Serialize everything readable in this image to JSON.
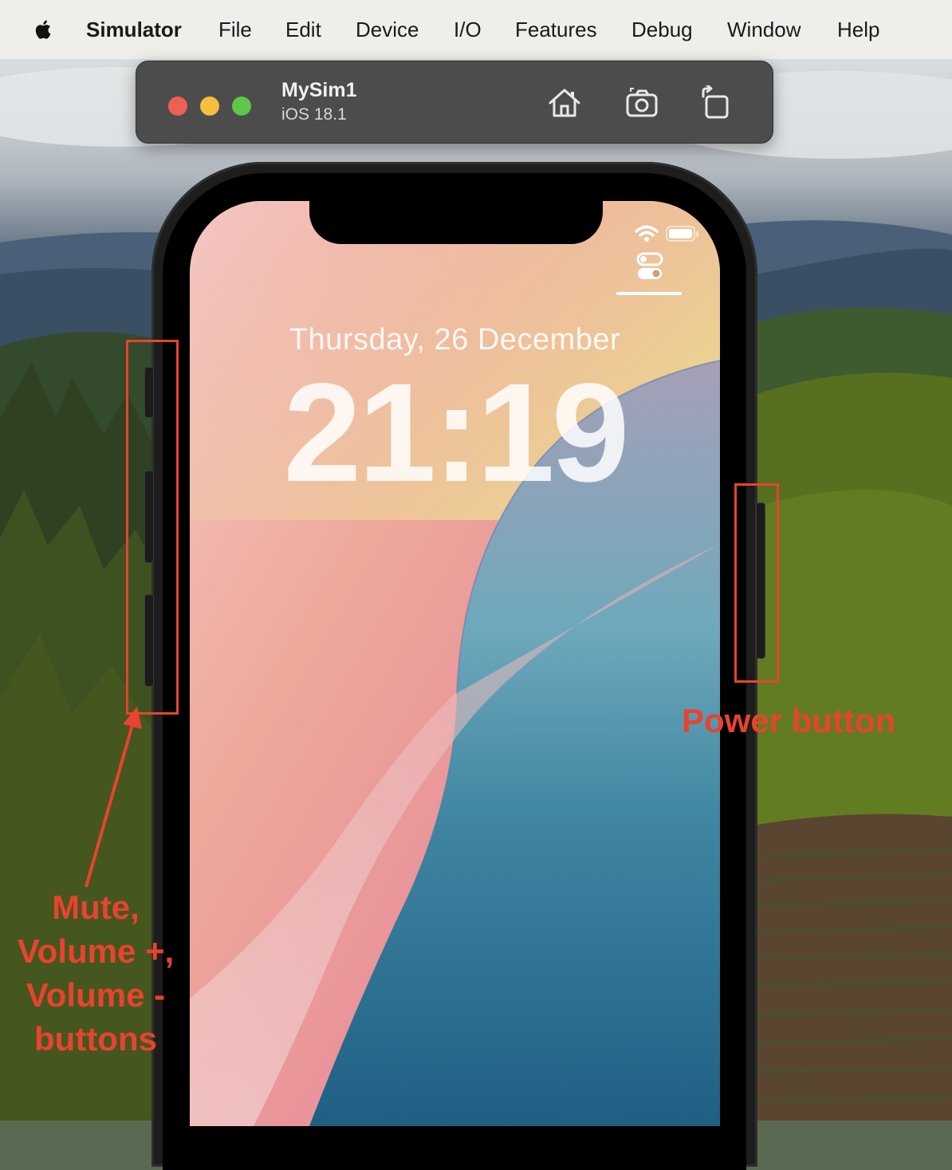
{
  "menubar": {
    "apple_icon": "apple-logo",
    "app_name": "Simulator",
    "items": [
      "File",
      "Edit",
      "Device",
      "I/O",
      "Features",
      "Debug",
      "Window",
      "Help"
    ]
  },
  "window": {
    "title": "MySim1",
    "subtitle": "iOS 18.1",
    "toolbar_icons": [
      "home-icon",
      "screenshot-icon",
      "rotate-icon"
    ]
  },
  "lockscreen": {
    "date": "Thursday, 26 December",
    "time": "21:19",
    "status_icons": [
      "wifi-icon",
      "battery-icon"
    ],
    "control_icon": "toggle-icon"
  },
  "annotations": {
    "power": "Power button",
    "volume_lines": [
      "Mute,",
      "Volume +,",
      "Volume -",
      "buttons"
    ],
    "color": "#e8432e"
  },
  "colors": {
    "menubar_bg": "#efeeeb",
    "toolbar_bg": "#4d4c4c",
    "traffic_close": "#ee5f56",
    "traffic_min": "#f5be3d",
    "traffic_max": "#5cc748"
  }
}
